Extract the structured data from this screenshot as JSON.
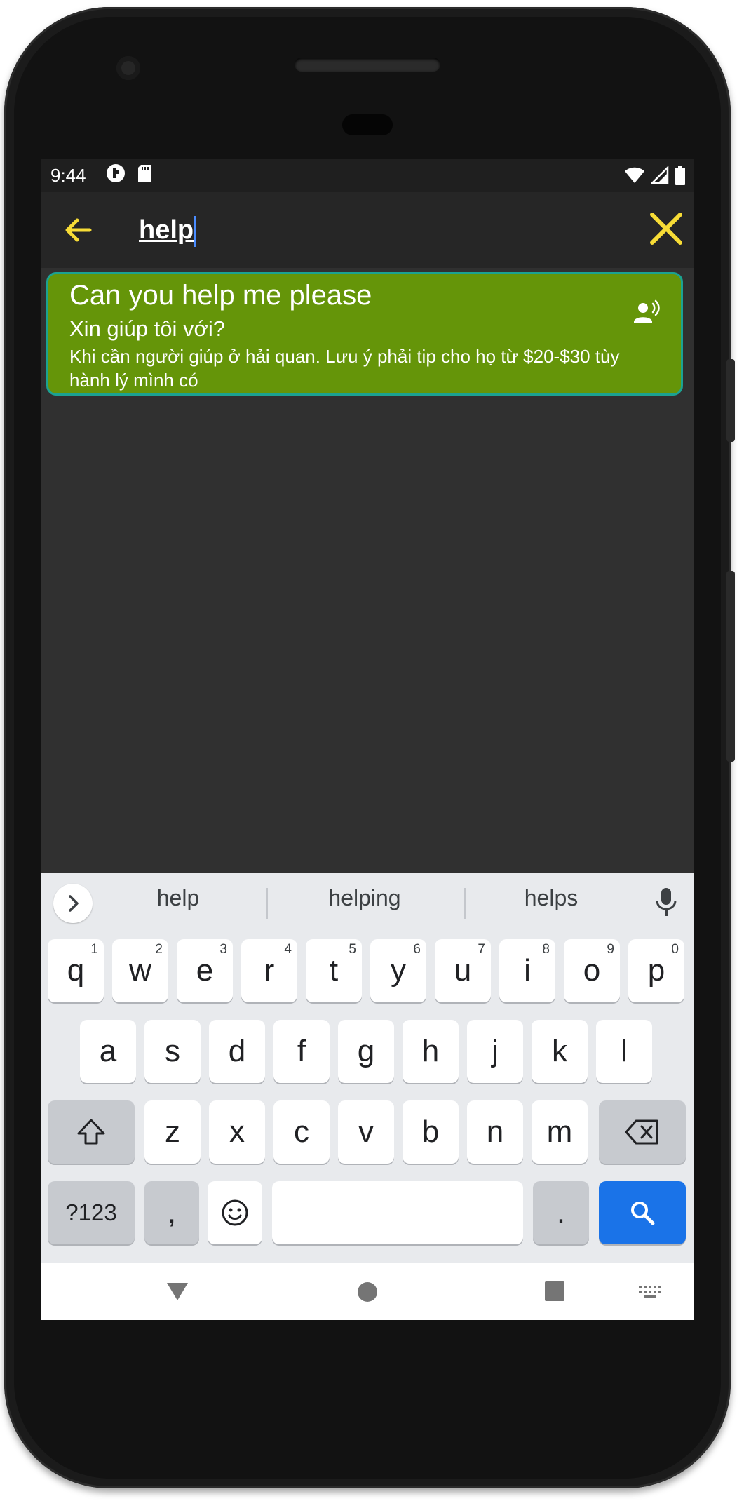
{
  "status_bar": {
    "time": "9:44"
  },
  "search": {
    "query": "help"
  },
  "result": {
    "title": "Can you help me please",
    "translation": "Xin giúp tôi với?",
    "note": "Khi cần người giúp ở hải quan. Lưu ý phải tip cho họ từ $20-$30 tùy hành lý mình có"
  },
  "suggestions": [
    "help",
    "helping",
    "helps"
  ],
  "keyboard": {
    "row1": [
      {
        "k": "q",
        "h": "1"
      },
      {
        "k": "w",
        "h": "2"
      },
      {
        "k": "e",
        "h": "3"
      },
      {
        "k": "r",
        "h": "4"
      },
      {
        "k": "t",
        "h": "5"
      },
      {
        "k": "y",
        "h": "6"
      },
      {
        "k": "u",
        "h": "7"
      },
      {
        "k": "i",
        "h": "8"
      },
      {
        "k": "o",
        "h": "9"
      },
      {
        "k": "p",
        "h": "0"
      }
    ],
    "row2": [
      "a",
      "s",
      "d",
      "f",
      "g",
      "h",
      "j",
      "k",
      "l"
    ],
    "row3": [
      "z",
      "x",
      "c",
      "v",
      "b",
      "n",
      "m"
    ],
    "symbols_key": "?123",
    "comma_key": ",",
    "period_key": "."
  },
  "colors": {
    "accent_yellow": "#f7dc36",
    "card_green": "#659509",
    "card_border": "#1ba292",
    "search_key_blue": "#1a73e8"
  },
  "icons": {
    "back": "arrow-left-icon",
    "clear": "close-icon",
    "speak": "speaker-person-icon",
    "expand": "chevron-right-icon",
    "mic": "microphone-icon",
    "shift": "shift-arrow-icon",
    "backspace": "backspace-icon",
    "emoji": "emoji-icon",
    "search": "search-icon"
  }
}
